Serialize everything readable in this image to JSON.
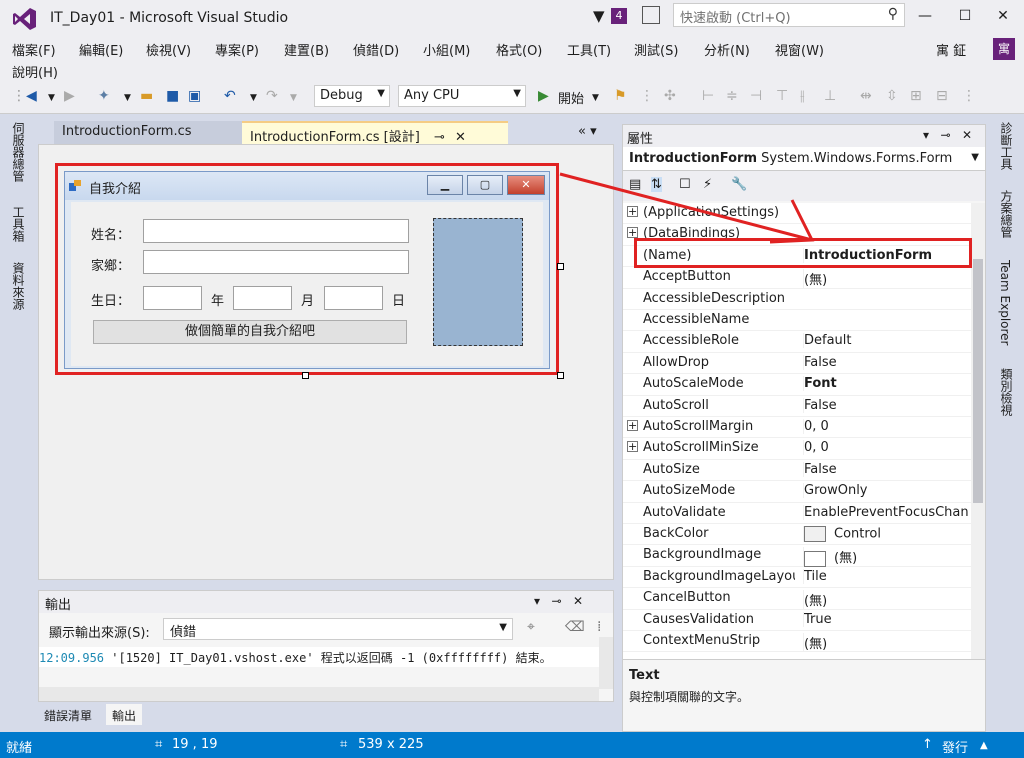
{
  "window": {
    "title": "IT_Day01 - Microsoft Visual Studio",
    "notification_count": "4",
    "quick_launch_placeholder": "快速啟動 (Ctrl+Q)",
    "user_name": "寓 鉦",
    "user_initial": "寓"
  },
  "menu": [
    "檔案(F)",
    "編輯(E)",
    "檢視(V)",
    "專案(P)",
    "建置(B)",
    "偵錯(D)",
    "小組(M)",
    "格式(O)",
    "工具(T)",
    "測試(S)",
    "分析(N)",
    "視窗(W)",
    "說明(H)"
  ],
  "toolbar": {
    "config": "Debug",
    "platform": "Any CPU",
    "start": "開始"
  },
  "left_tabs": [
    "伺服器總管",
    "工具箱",
    "資料來源"
  ],
  "right_tabs": [
    "診斷工具",
    "方案總管",
    "Team Explorer",
    "類別檢視"
  ],
  "doc_tabs": {
    "tab1": "IntroductionForm.cs",
    "tab2": "IntroductionForm.cs [設計]"
  },
  "form": {
    "title": "自我介紹",
    "name_label": "姓名：",
    "home_label": "家鄉：",
    "birthday_label": "生日：",
    "year": "年",
    "month": "月",
    "day": "日",
    "button": "做個簡單的自我介紹吧"
  },
  "output": {
    "title": "輸出",
    "source_label": "顯示輸出來源(S):",
    "source_value": "偵錯",
    "time": "12:09.956",
    "message": " '[1520] IT_Day01.vshost.exe' 程式以返回碼 -1 (0xffffffff) 結束。",
    "tabs": [
      "錯誤清單",
      "輸出"
    ]
  },
  "properties": {
    "title": "屬性",
    "object_name": "IntroductionForm",
    "object_type": "System.Windows.Forms.Form",
    "rows": [
      {
        "name": "(ApplicationSettings)",
        "value": "",
        "exp": true
      },
      {
        "name": "(DataBindings)",
        "value": "",
        "exp": true
      },
      {
        "name": "(Name)",
        "value": "IntroductionForm",
        "bold": true
      },
      {
        "name": "AcceptButton",
        "value": "(無)"
      },
      {
        "name": "AccessibleDescription",
        "value": ""
      },
      {
        "name": "AccessibleName",
        "value": ""
      },
      {
        "name": "AccessibleRole",
        "value": "Default"
      },
      {
        "name": "AllowDrop",
        "value": "False"
      },
      {
        "name": "AutoScaleMode",
        "value": "Font",
        "bold": true
      },
      {
        "name": "AutoScroll",
        "value": "False"
      },
      {
        "name": "AutoScrollMargin",
        "value": "0, 0",
        "exp": true
      },
      {
        "name": "AutoScrollMinSize",
        "value": "0, 0",
        "exp": true
      },
      {
        "name": "AutoSize",
        "value": "False"
      },
      {
        "name": "AutoSizeMode",
        "value": "GrowOnly"
      },
      {
        "name": "AutoValidate",
        "value": "EnablePreventFocusChange"
      },
      {
        "name": "BackColor",
        "value": "Control",
        "swatch": "#f0f0f0"
      },
      {
        "name": "BackgroundImage",
        "value": "(無)",
        "swatch": "#ffffff"
      },
      {
        "name": "BackgroundImageLayout",
        "value": "Tile"
      },
      {
        "name": "CancelButton",
        "value": "(無)"
      },
      {
        "name": "CausesValidation",
        "value": "True"
      },
      {
        "name": "ContextMenuStrip",
        "value": "(無)"
      }
    ],
    "desc_title": "Text",
    "desc_text": "與控制項關聯的文字。"
  },
  "status": {
    "ready": "就緒",
    "position": "19 , 19",
    "size": "539 x 225",
    "publish": "發行"
  },
  "colors": {
    "accent": "#68217a",
    "statusbar": "#007acc",
    "highlight": "#e02222"
  }
}
